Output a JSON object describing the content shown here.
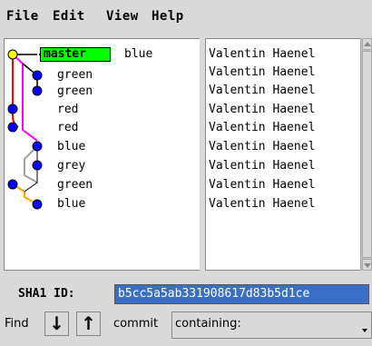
{
  "menu": [
    "File",
    "Edit",
    "View",
    "Help"
  ],
  "head_branch": "master",
  "commits": [
    {
      "subject": "blue",
      "author": "Valentin Haenel"
    },
    {
      "subject": "green",
      "author": "Valentin Haenel"
    },
    {
      "subject": "green",
      "author": "Valentin Haenel"
    },
    {
      "subject": "red",
      "author": "Valentin Haenel"
    },
    {
      "subject": "red",
      "author": "Valentin Haenel"
    },
    {
      "subject": "blue",
      "author": "Valentin Haenel"
    },
    {
      "subject": "grey",
      "author": "Valentin Haenel"
    },
    {
      "subject": "green",
      "author": "Valentin Haenel"
    },
    {
      "subject": "blue",
      "author": "Valentin Haenel"
    }
  ],
  "sha": {
    "label": "SHA1 ID:",
    "value": "b5cc5a5ab331908617d83b5d1ce"
  },
  "find": {
    "label": "Find",
    "down": "↓",
    "up": "↑",
    "type": "commit",
    "mode": "containing:"
  },
  "colors": {
    "head_dot": "#ffff00",
    "dot": "#0000ff",
    "branch_tag": "#00ff00",
    "sha_bg": "#3b6fc7"
  }
}
